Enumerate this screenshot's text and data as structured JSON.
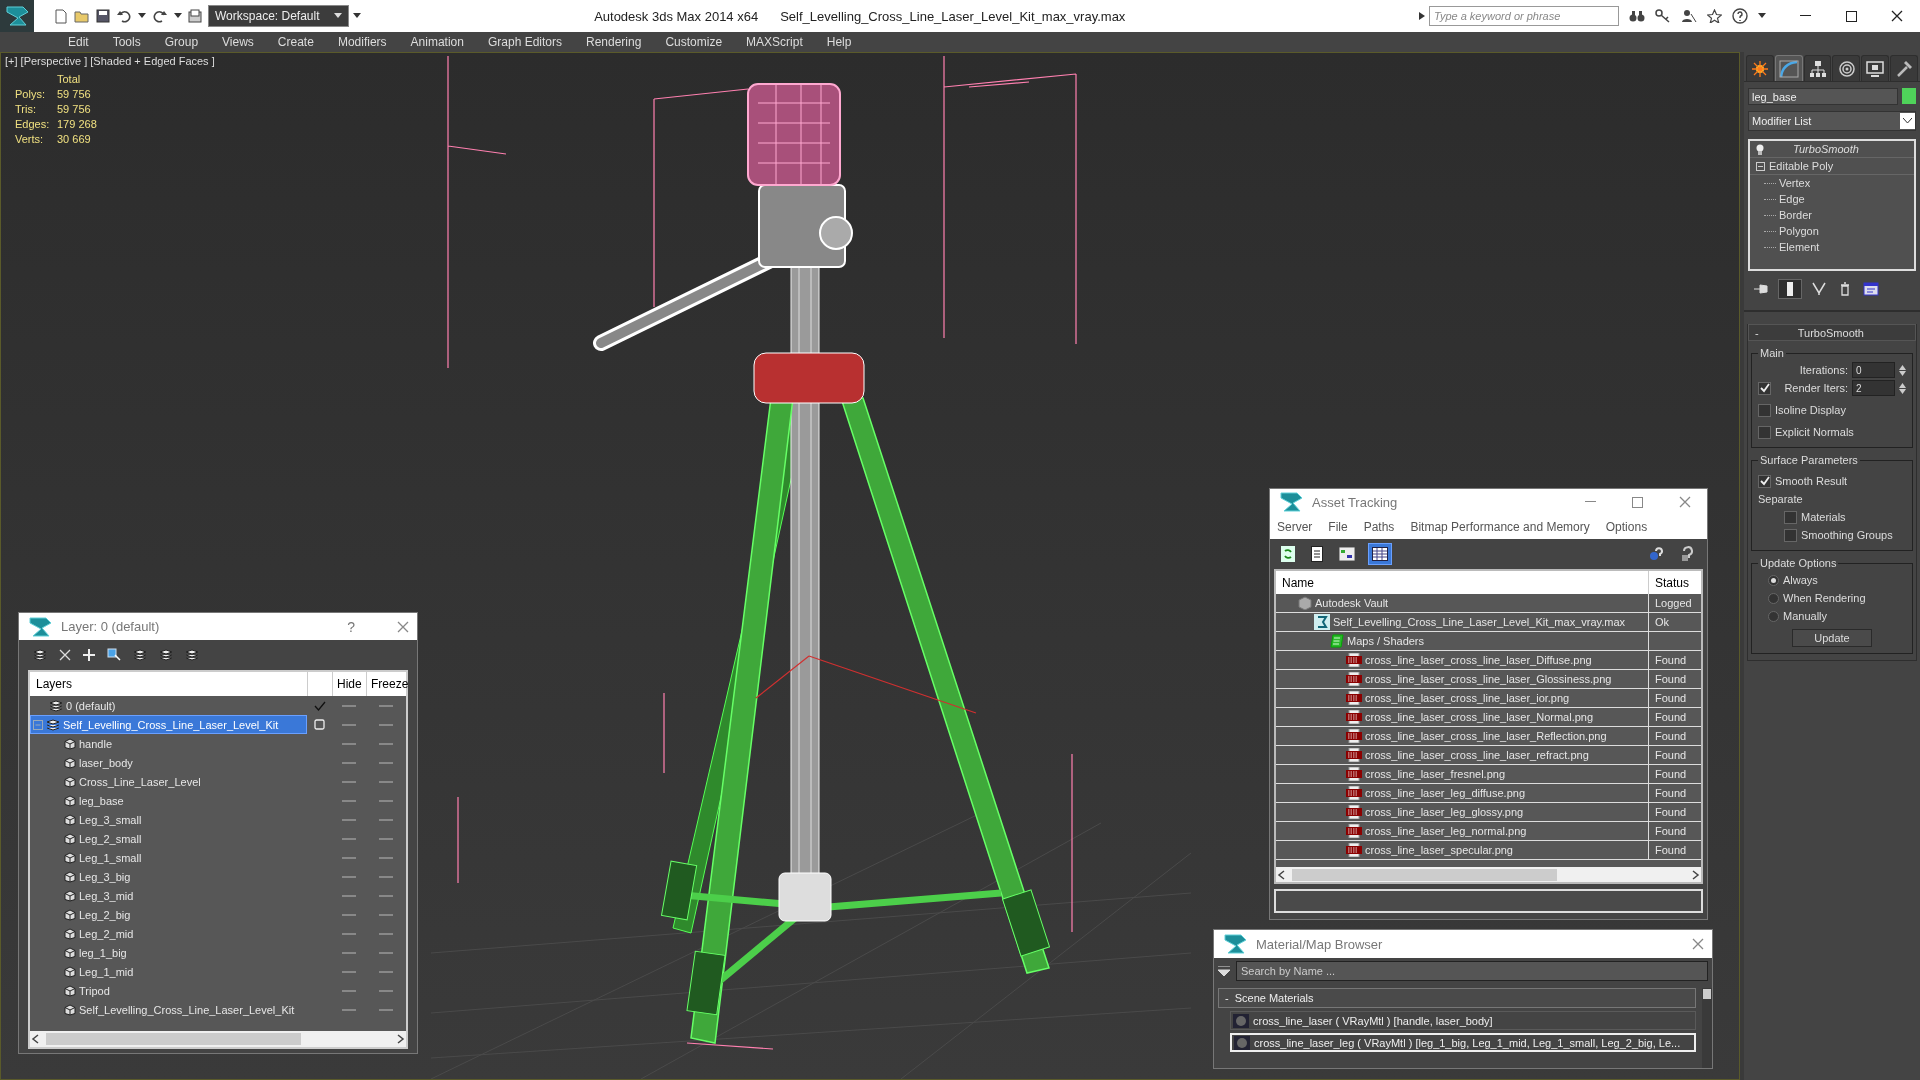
{
  "window": {
    "app_title": "Autodesk 3ds Max  2014 x64",
    "file_title": "Self_Levelling_Cross_Line_Laser_Level_Kit_max_vray.max",
    "workspace": "Workspace: Default",
    "search_placeholder": "Type a keyword or phrase"
  },
  "menu": [
    "Edit",
    "Tools",
    "Group",
    "Views",
    "Create",
    "Modifiers",
    "Animation",
    "Graph Editors",
    "Rendering",
    "Customize",
    "MAXScript",
    "Help"
  ],
  "viewport": {
    "label": "[+] [Perspective ] [Shaded + Edged Faces ]",
    "stats_header": "Total",
    "stats": [
      {
        "label": "Polys:",
        "value": "59 756"
      },
      {
        "label": "Tris:",
        "value": "59 756"
      },
      {
        "label": "Edges:",
        "value": "179 268"
      },
      {
        "label": "Verts:",
        "value": "30 669"
      }
    ]
  },
  "command_panel": {
    "tabs": [
      {
        "kind": "create",
        "selected": false
      },
      {
        "kind": "modify",
        "selected": true
      },
      {
        "kind": "hierarchy",
        "selected": false
      },
      {
        "kind": "motion",
        "selected": false
      },
      {
        "kind": "display",
        "selected": false
      },
      {
        "kind": "utilities",
        "selected": false
      }
    ],
    "object_name": "leg_base",
    "modifier_list": "Modifier List",
    "stack": [
      {
        "label": "TurboSmooth",
        "kind": "modifier"
      },
      {
        "label": "Editable Poly",
        "kind": "base",
        "expanded": true,
        "children": [
          {
            "label": "Vertex"
          },
          {
            "label": "Edge"
          },
          {
            "label": "Border"
          },
          {
            "label": "Polygon"
          },
          {
            "label": "Element"
          }
        ]
      }
    ],
    "stack_tools": [
      {
        "kind": "pin",
        "selected": false
      },
      {
        "kind": "end_result",
        "selected": true
      },
      {
        "kind": "unique",
        "selected": false
      },
      {
        "kind": "remove",
        "selected": false
      },
      {
        "kind": "configure",
        "selected": false
      }
    ],
    "rollout": {
      "toggle": "-",
      "title": "TurboSmooth",
      "groups": [
        {
          "title": "Main",
          "items": [
            {
              "kind": "spinner",
              "label": "Iterations:",
              "value": "0"
            },
            {
              "kind": "check_spinner",
              "label": "Render Iters:",
              "value": "2",
              "checked": true
            },
            {
              "kind": "checkbox",
              "label": "Isoline Display",
              "checked": false
            },
            {
              "kind": "checkbox",
              "label": "Explicit Normals",
              "checked": false
            }
          ]
        },
        {
          "title": "Surface Parameters",
          "items": [
            {
              "kind": "checkbox",
              "label": "Smooth Result",
              "checked": true
            },
            {
              "kind": "text",
              "label": "Separate"
            },
            {
              "kind": "subcheckbox",
              "label": "Materials",
              "checked": false
            },
            {
              "kind": "subcheckbox",
              "label": "Smoothing Groups",
              "checked": false
            }
          ]
        },
        {
          "title": "Update Options",
          "items": [
            {
              "kind": "radio",
              "label": "Always",
              "selected": true
            },
            {
              "kind": "radio",
              "label": "When Rendering",
              "selected": false
            },
            {
              "kind": "radio",
              "label": "Manually",
              "selected": false
            },
            {
              "kind": "button",
              "label": "Update"
            }
          ]
        }
      ]
    }
  },
  "layer_window": {
    "title": "Layer: 0 (default)",
    "help": "?",
    "columns": [
      "Layers",
      "Hide",
      "Freeze"
    ],
    "rows": [
      {
        "name": "0 (default)",
        "kind": "layer",
        "current": true,
        "selected": false
      },
      {
        "name": "Self_Levelling_Cross_Line_Laser_Level_Kit",
        "kind": "layer",
        "current": false,
        "selected": true,
        "expanded": true,
        "children": [
          {
            "name": "handle",
            "kind": "object"
          },
          {
            "name": "laser_body",
            "kind": "object"
          },
          {
            "name": "Cross_Line_Laser_Level",
            "kind": "object"
          },
          {
            "name": "leg_base",
            "kind": "object"
          },
          {
            "name": "Leg_3_small",
            "kind": "object"
          },
          {
            "name": "Leg_2_small",
            "kind": "object"
          },
          {
            "name": "Leg_1_small",
            "kind": "object"
          },
          {
            "name": "Leg_3_big",
            "kind": "object"
          },
          {
            "name": "Leg_3_mid",
            "kind": "object"
          },
          {
            "name": "Leg_2_big",
            "kind": "object"
          },
          {
            "name": "Leg_2_mid",
            "kind": "object"
          },
          {
            "name": "leg_1_big",
            "kind": "object"
          },
          {
            "name": "Leg_1_mid",
            "kind": "object"
          },
          {
            "name": "Tripod",
            "kind": "object"
          },
          {
            "name": "Self_Levelling_Cross_Line_Laser_Level_Kit",
            "kind": "object"
          }
        ]
      }
    ]
  },
  "asset_window": {
    "title": "Asset Tracking",
    "menu": [
      "Server",
      "File",
      "Paths",
      "Bitmap Performance and Memory",
      "Options"
    ],
    "toolbar": [
      {
        "kind": "refresh",
        "selected": false
      },
      {
        "kind": "list",
        "selected": false
      },
      {
        "kind": "thumbnails",
        "selected": false
      },
      {
        "kind": "table",
        "selected": true
      }
    ],
    "columns": [
      "Name",
      "Status"
    ],
    "rows": [
      {
        "name": "Autodesk Vault",
        "kind": "vault",
        "status": "Logged",
        "children": [
          {
            "name": "Self_Levelling_Cross_Line_Laser_Level_Kit_max_vray.max",
            "kind": "scene",
            "status": "Ok",
            "children": [
              {
                "name": "Maps / Shaders",
                "kind": "folder",
                "children": [
                  {
                    "name": "cross_line_laser_cross_line_laser_Diffuse.png",
                    "kind": "png",
                    "status": "Found"
                  },
                  {
                    "name": "cross_line_laser_cross_line_laser_Glossiness.png",
                    "kind": "png",
                    "status": "Found"
                  },
                  {
                    "name": "cross_line_laser_cross_line_laser_ior.png",
                    "kind": "png",
                    "status": "Found"
                  },
                  {
                    "name": "cross_line_laser_cross_line_laser_Normal.png",
                    "kind": "png",
                    "status": "Found"
                  },
                  {
                    "name": "cross_line_laser_cross_line_laser_Reflection.png",
                    "kind": "png",
                    "status": "Found"
                  },
                  {
                    "name": "cross_line_laser_cross_line_laser_refract.png",
                    "kind": "png",
                    "status": "Found"
                  },
                  {
                    "name": "cross_line_laser_fresnel.png",
                    "kind": "png",
                    "status": "Found"
                  },
                  {
                    "name": "cross_line_laser_leg_diffuse.png",
                    "kind": "png",
                    "status": "Found"
                  },
                  {
                    "name": "cross_line_laser_leg_glossy.png",
                    "kind": "png",
                    "status": "Found"
                  },
                  {
                    "name": "cross_line_laser_leg_normal.png",
                    "kind": "png",
                    "status": "Found"
                  },
                  {
                    "name": "cross_line_laser_specular.png",
                    "kind": "png",
                    "status": "Found"
                  }
                ]
              }
            ]
          }
        ]
      }
    ]
  },
  "material_window": {
    "title": "Material/Map Browser",
    "search_placeholder": "Search by Name ...",
    "section": {
      "toggle": "-",
      "title": "Scene Materials"
    },
    "materials": [
      {
        "label": "cross_line_laser ( VRayMtl ) [handle, laser_body]",
        "selected": false
      },
      {
        "label": "cross_line_laser_leg ( VRayMtl ) [leg_1_big, Leg_1_mid, Leg_1_small, Leg_2_big, Le...",
        "selected": true
      }
    ]
  }
}
